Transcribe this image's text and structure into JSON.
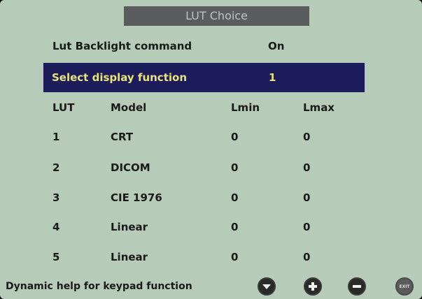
{
  "title": "LUT Choice",
  "backlight": {
    "label": "Lut Backlight command",
    "value": "On"
  },
  "display_function": {
    "label": "Select display function",
    "value": "1"
  },
  "table": {
    "headers": [
      "LUT",
      "Model",
      "Lmin",
      "Lmax"
    ],
    "rows": [
      [
        "1",
        "CRT",
        "0",
        "0"
      ],
      [
        "2",
        "DICOM",
        "0",
        "0"
      ],
      [
        "3",
        "CIE 1976",
        "0",
        "0"
      ],
      [
        "4",
        "Linear",
        "0",
        "0"
      ],
      [
        "5",
        "Linear",
        "0",
        "0"
      ]
    ]
  },
  "footer": {
    "help": "Dynamic help for keypad function",
    "keys": [
      "down-icon",
      "plus-icon",
      "minus-icon",
      "exit-icon"
    ],
    "exit_label": "EXIT"
  },
  "colors": {
    "background": "#b6ccb8",
    "title_bar": "#5a5c5e",
    "highlight_bg": "#1b1c59",
    "highlight_text": "#e8e37a"
  }
}
